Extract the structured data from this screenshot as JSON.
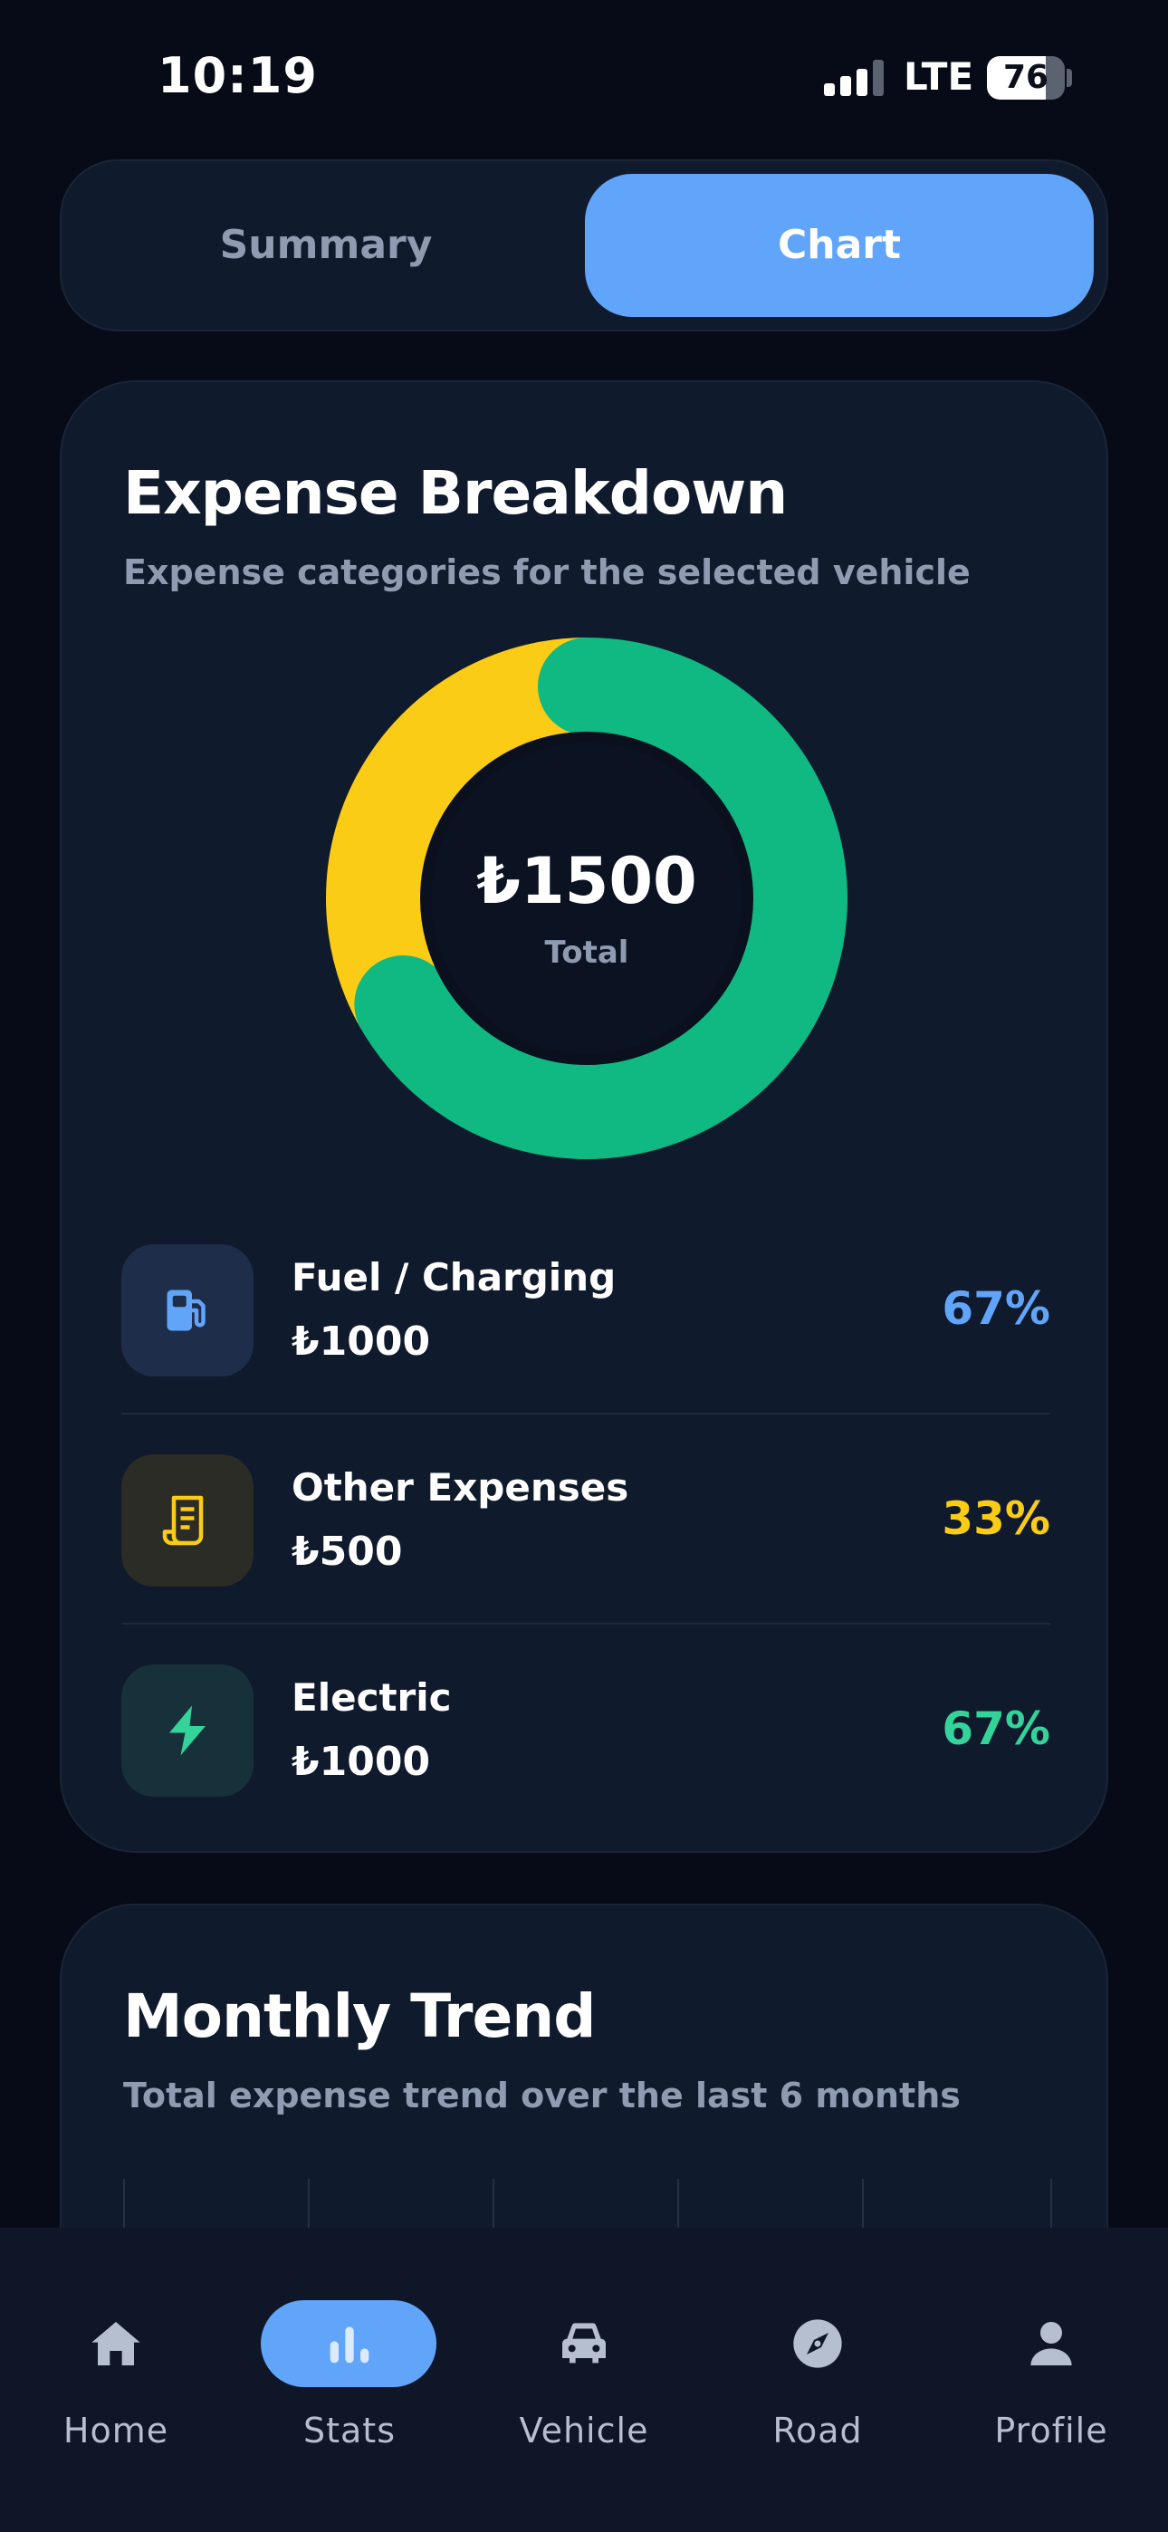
{
  "status_bar": {
    "time": "10:19",
    "network": "LTE",
    "battery": "76",
    "battery_level": 0.76
  },
  "tabs": {
    "summary": "Summary",
    "chart": "Chart",
    "active": "chart"
  },
  "breakdown": {
    "title": "Expense Breakdown",
    "subtitle": "Expense categories for the selected vehicle",
    "total": "₺1500",
    "total_label": "Total",
    "chart_data": {
      "type": "pie",
      "values": [
        1000,
        500
      ],
      "colors": [
        "#10b981",
        "#facc15"
      ]
    },
    "items": [
      {
        "name": "Fuel / Charging",
        "amount": "₺1000",
        "percent": "67%",
        "color": "#60a5fa",
        "icon": "fuel-pump-icon"
      },
      {
        "name": "Other Expenses",
        "amount": "₺500",
        "percent": "33%",
        "color": "#facc15",
        "icon": "receipt-icon"
      },
      {
        "name": "Electric",
        "amount": "₺1000",
        "percent": "67%",
        "color": "#34d399",
        "icon": "lightning-icon"
      }
    ]
  },
  "trend": {
    "title": "Monthly Trend",
    "subtitle": "Total expense trend over the last 6 months"
  },
  "nav": {
    "active": "stats",
    "items": [
      {
        "label": "Home",
        "icon": "home-icon"
      },
      {
        "label": "Stats",
        "icon": "stats-icon"
      },
      {
        "label": "Vehicle",
        "icon": "car-icon"
      },
      {
        "label": "Road",
        "icon": "compass-icon"
      },
      {
        "label": "Profile",
        "icon": "person-icon"
      }
    ]
  },
  "colors": {
    "accent": "#60a5fa",
    "background": "#060b17",
    "card": "#101a2d"
  }
}
